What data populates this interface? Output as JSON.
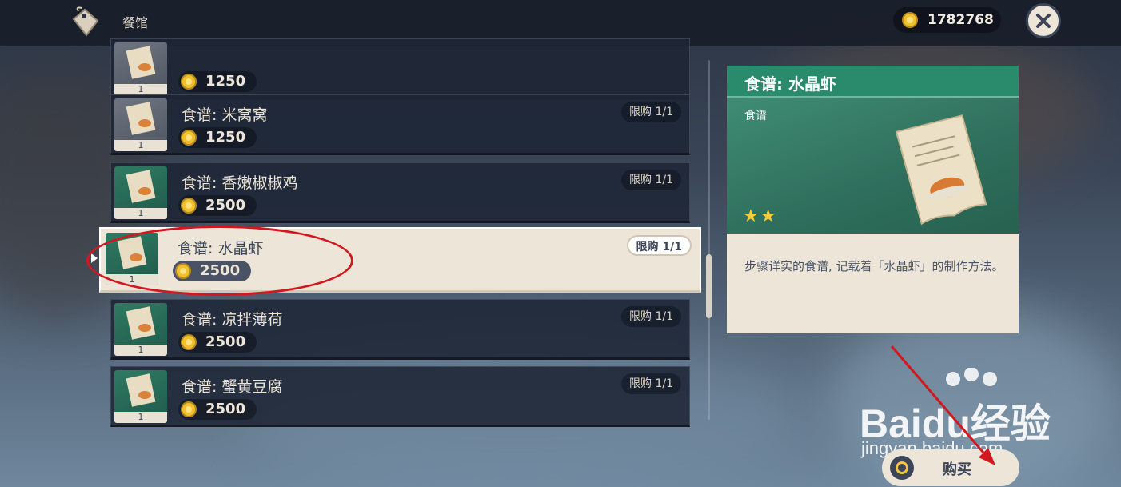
{
  "header": {
    "shop_title": "餐馆",
    "currency_amount": "1782768"
  },
  "shop_items": [
    {
      "name": "",
      "price": "1250",
      "limit": "",
      "count": "1"
    },
    {
      "name": "食谱: 米窝窝",
      "price": "1250",
      "limit": "限购 1/1",
      "count": "1"
    },
    {
      "name": "食谱: 香嫩椒椒鸡",
      "price": "2500",
      "limit": "限购 1/1",
      "count": "1"
    },
    {
      "name": "食谱: 水晶虾",
      "price": "2500",
      "limit": "限购 1/1",
      "count": "1"
    },
    {
      "name": "食谱: 凉拌薄荷",
      "price": "2500",
      "limit": "限购 1/1",
      "count": "1"
    },
    {
      "name": "食谱: 蟹黄豆腐",
      "price": "2500",
      "limit": "限购 1/1",
      "count": "1"
    }
  ],
  "detail": {
    "title": "食谱: 水晶虾",
    "category": "食谱",
    "stars": "★★",
    "description": "步骤详实的食谱, 记载着「水晶虾」的制作方法。"
  },
  "buy_button": {
    "label": "购买"
  },
  "watermark": {
    "brand": "Baidu经验",
    "url": "jingyan.baidu.com"
  },
  "colors": {
    "accent_green": "#2a8a6c",
    "cream": "#ece5d8",
    "annotation_red": "#d2181f",
    "star": "#ffcc33"
  },
  "icons": [
    "price-tag-icon",
    "coin-icon",
    "close-icon",
    "recipe-scroll-icon",
    "buy-coin-icon"
  ]
}
